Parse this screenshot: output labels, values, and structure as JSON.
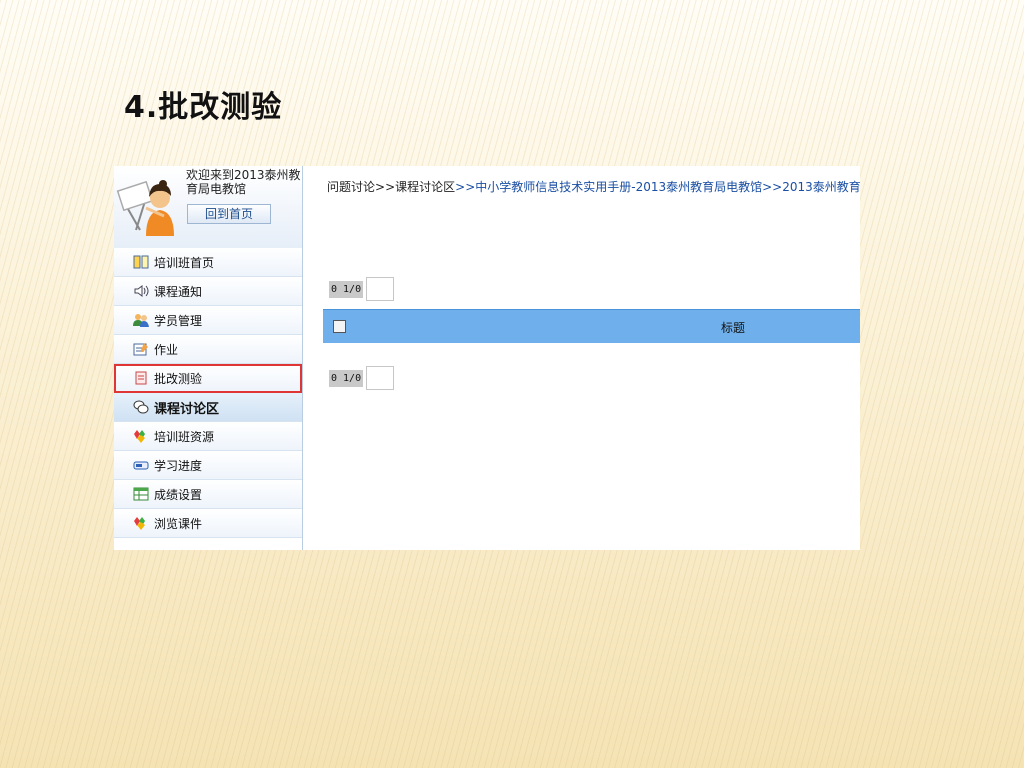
{
  "slide": {
    "title": "4.批改测验"
  },
  "profile": {
    "welcome": "欢迎来到2013泰州教育局电教馆",
    "home_button": "回到首页"
  },
  "nav": {
    "items": [
      {
        "label": "培训班首页",
        "icon": "book-icon"
      },
      {
        "label": "课程通知",
        "icon": "speaker-icon"
      },
      {
        "label": "学员管理",
        "icon": "users-icon"
      },
      {
        "label": "作业",
        "icon": "notepad-icon"
      },
      {
        "label": "批改测验",
        "icon": "grade-quiz-icon"
      },
      {
        "label": "课程讨论区",
        "icon": "chat-icon"
      },
      {
        "label": "培训班资源",
        "icon": "gems-icon"
      },
      {
        "label": "学习进度",
        "icon": "progress-icon"
      },
      {
        "label": "成绩设置",
        "icon": "grid-icon"
      },
      {
        "label": "浏览课件",
        "icon": "gems-icon"
      }
    ]
  },
  "breadcrumb": {
    "part1": "问题讨论",
    "sep": ">>",
    "part2": "课程讨论区",
    "part3": "中小学教师信息技术实用手册-2013泰州教育局电教馆",
    "part4": "2013泰州教育"
  },
  "pager_top": {
    "text": "0 1/0"
  },
  "pager_bottom": {
    "text": "0 1/0"
  },
  "table": {
    "header_title": "标题"
  },
  "colors": {
    "accent": "#6fb0ec",
    "highlight": "#e03535",
    "link": "#1a4fa3"
  }
}
